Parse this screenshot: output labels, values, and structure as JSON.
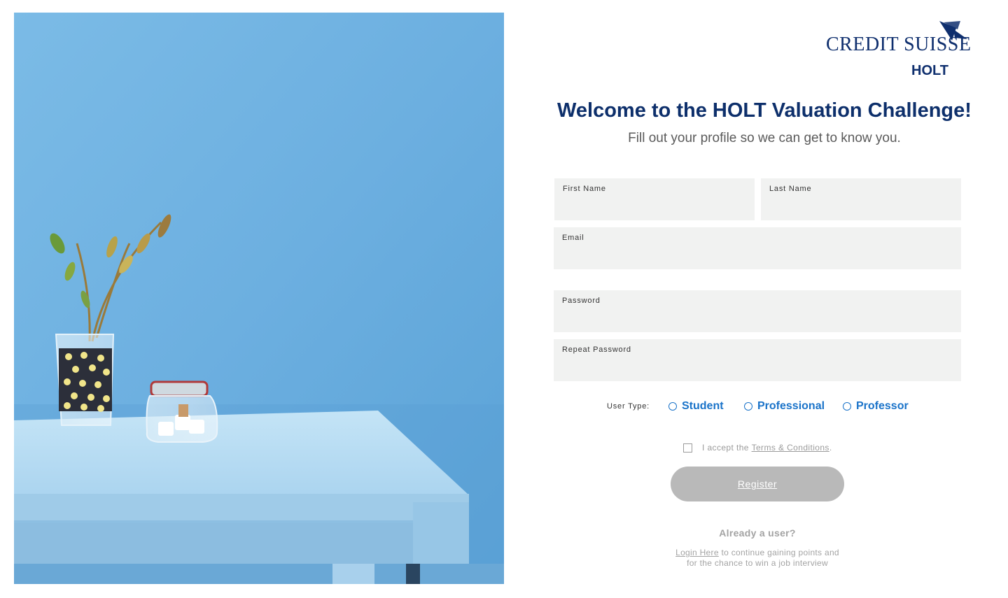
{
  "brand": {
    "logo_word": "CREDIT SUISSE",
    "logo_sub": "HOLT",
    "logo_color": "#0f2f6e",
    "logo_icon": "sails-icon"
  },
  "header": {
    "title": "Welcome to the HOLT Valuation Challenge!",
    "subtitle": "Fill out your profile so we can get to know you."
  },
  "form": {
    "first_name_label": "First Name",
    "last_name_label": "Last Name",
    "email_label": "Email",
    "password_label": "Password",
    "repeat_password_label": "Repeat Password",
    "first_name_value": "",
    "last_name_value": "",
    "email_value": "",
    "password_value": "",
    "repeat_password_value": "",
    "user_type_label": "User Type:",
    "user_types": [
      "Student",
      "Professional",
      "Professor"
    ],
    "terms_prefix": "I accept the ",
    "terms_link": "Terms & Conditions",
    "terms_suffix": ".",
    "register_label": "Register"
  },
  "footer": {
    "already_user": "Already a user?",
    "login_link": "Login Here",
    "login_rest_line1": " to continue gaining points and",
    "login_rest_line2": "for the chance to win a job interview"
  },
  "colors": {
    "title": "#0d2f6b",
    "radio": "#1a73c9",
    "field_bg": "#f1f2f1",
    "button_disabled": "#b9b9b9",
    "wall": "#72b3e0",
    "table": "#b8dcf2"
  },
  "hero": {
    "description_icon": "hero-photo"
  }
}
